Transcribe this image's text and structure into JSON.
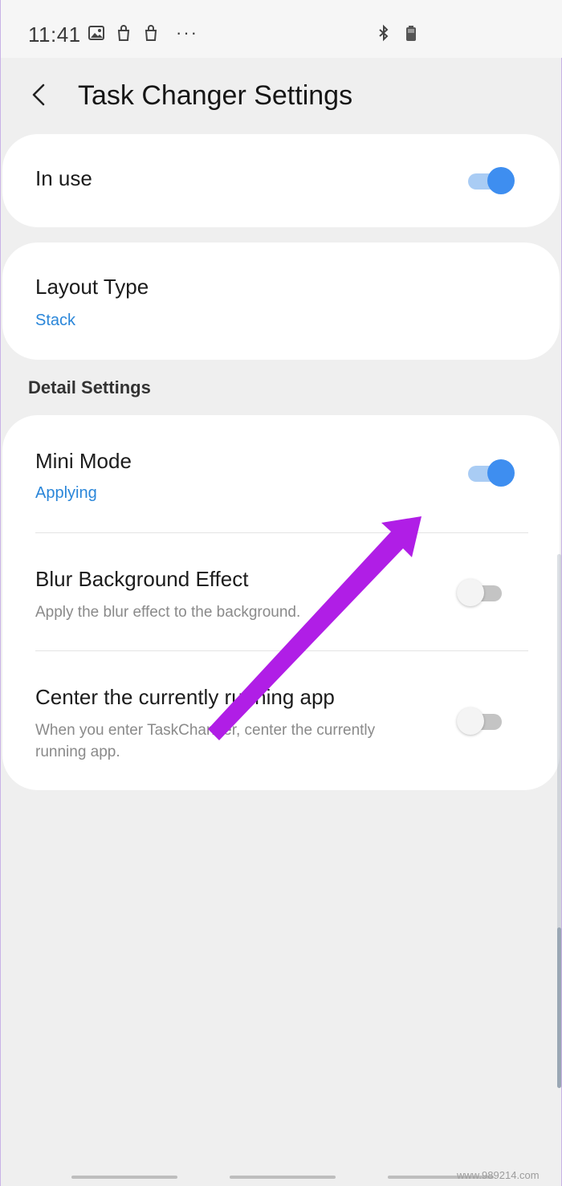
{
  "status_bar": {
    "time": "11:41",
    "more": "···",
    "left_icons": [
      "gallery-icon",
      "bag-icon",
      "bag-icon"
    ],
    "right_icons": [
      "bluetooth-icon",
      "battery-icon"
    ]
  },
  "header": {
    "title": "Task Changer Settings",
    "back_icon": "back-arrow-icon"
  },
  "in_use": {
    "label": "In use",
    "enabled": true
  },
  "layout_type": {
    "label": "Layout Type",
    "value": "Stack"
  },
  "detail_settings": {
    "section_label": "Detail Settings",
    "mini_mode": {
      "label": "Mini Mode",
      "status": "Applying",
      "enabled": true
    },
    "blur_background": {
      "label": "Blur Background Effect",
      "description": "Apply the blur effect to the background.",
      "enabled": false
    },
    "center_app": {
      "label": "Center the currently running app",
      "description": "When you enter TaskChanger, center the currently running app.",
      "enabled": false
    }
  },
  "annotation": {
    "arrow_color": "#b01ee6"
  },
  "colors": {
    "accent_blue": "#3e8ef0",
    "link_blue": "#2a86d9"
  },
  "watermark": "www.989214.com"
}
